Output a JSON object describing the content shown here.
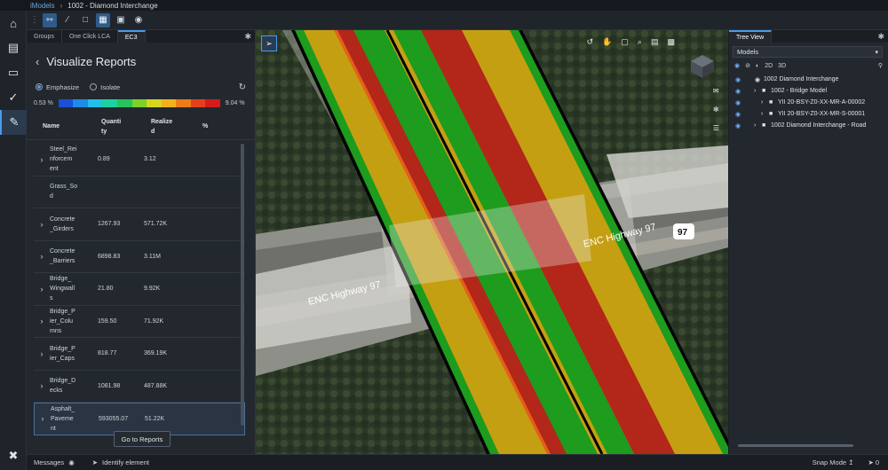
{
  "breadcrumb": {
    "root": "iModels",
    "current": "1002 - Diamond Interchange"
  },
  "toolbar": {
    "tools": [
      "grip-icon",
      "measure-icon",
      "line-icon",
      "square-icon",
      "select-box-icon",
      "cube-icon",
      "sphere-icon"
    ]
  },
  "left_rail": {
    "items": [
      "home-icon",
      "report-icon",
      "documents-icon",
      "check-icon",
      "paint-icon"
    ],
    "bottom": "tools-icon"
  },
  "panel": {
    "tabs": [
      "Groups",
      "One Click LCA",
      "EC3"
    ],
    "active_tab": "EC3",
    "title": "Visualize Reports",
    "radio_emphasize": "Emphasize",
    "radio_isolate": "Isolate",
    "legend_min": "0.53 %",
    "legend_max": "9.04 %",
    "legend_colors": [
      "#1a4fd6",
      "#1f8be8",
      "#23c0e6",
      "#1fd1a0",
      "#26c45a",
      "#7cd22a",
      "#d6d61e",
      "#f0b21c",
      "#ee7a18",
      "#e3411a",
      "#d61b1b"
    ],
    "columns": {
      "name": "Name",
      "quantity": "Quanti\nty",
      "realized": "Realize\nd",
      "percent": "%"
    },
    "rows": [
      {
        "name": "Steel_Rei\nnforcem\nent",
        "quantity": "0.89",
        "realized": "3.12",
        "expand": true
      },
      {
        "name": "Grass_So\nd",
        "quantity": "",
        "realized": "",
        "expand": false
      },
      {
        "name": "Concrete\n_Girders",
        "quantity": "1267.93",
        "realized": "571.72K",
        "expand": true
      },
      {
        "name": "Concrete\n_Barriers",
        "quantity": "6898.83",
        "realized": "3.11M",
        "expand": true
      },
      {
        "name": "Bridge_\nWingwall\ns",
        "quantity": "21.80",
        "realized": "9.92K",
        "expand": true
      },
      {
        "name": "Bridge_P\nier_Colu\nmns",
        "quantity": "159.50",
        "realized": "71.92K",
        "expand": true
      },
      {
        "name": "Bridge_P\nier_Caps",
        "quantity": "818.77",
        "realized": "369.19K",
        "expand": true
      },
      {
        "name": "Bridge_D\necks",
        "quantity": "1081.98",
        "realized": "487.88K",
        "expand": true
      },
      {
        "name": "Asphalt_\nPaveme\nnt",
        "quantity": "593055.07",
        "realized": "51.22K",
        "expand": true
      }
    ],
    "go_button": "Go to Reports"
  },
  "map": {
    "road_label_left": "ENC Highway 97",
    "road_label_right": "ENC Highway 97",
    "shield": "97"
  },
  "tree": {
    "tab": "Tree View",
    "dropdown": "Models",
    "tools": [
      "2D",
      "3D"
    ],
    "nodes": [
      {
        "label": "1002 Diamond Interchange",
        "depth": 0,
        "icon": "model-icon"
      },
      {
        "label": "1002 - Bridge Model",
        "depth": 1,
        "icon": "folder-icon"
      },
      {
        "label": "YII 20-BSY-Z0-XX-MR-A-00002",
        "depth": 2,
        "icon": "folder-icon"
      },
      {
        "label": "YII 20-BSY-Z0-XX-MR-S-00001",
        "depth": 2,
        "icon": "folder-icon"
      },
      {
        "label": "1002 Diamond Interchange - Road",
        "depth": 1,
        "icon": "folder-icon"
      }
    ]
  },
  "status": {
    "messages": "Messages",
    "identify": "Identify element",
    "snap": "Snap Mode",
    "count": "0"
  }
}
